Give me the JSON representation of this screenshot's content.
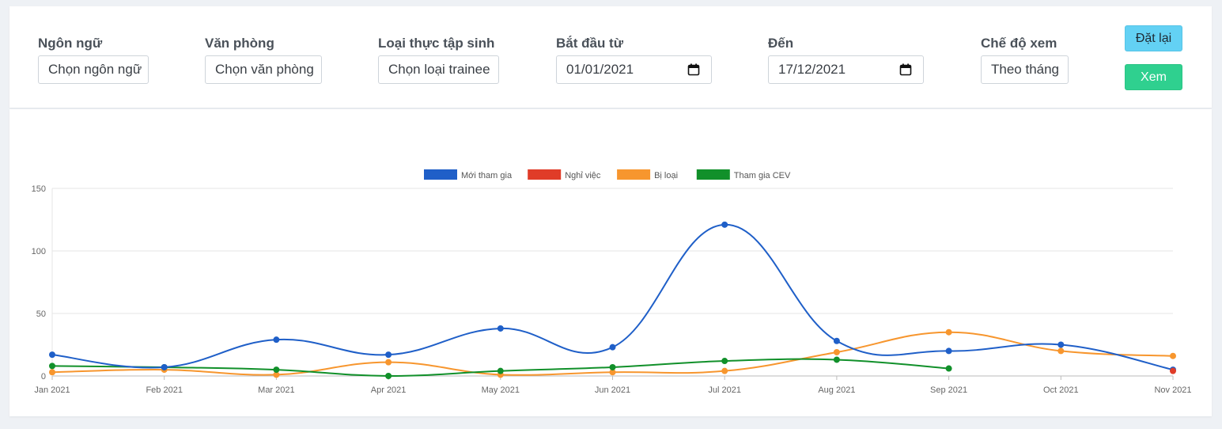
{
  "filters": {
    "language": {
      "label": "Ngôn ngữ",
      "value": "Chọn ngôn ngữ"
    },
    "office": {
      "label": "Văn phòng",
      "value": "Chọn văn phòng"
    },
    "trainee_type": {
      "label": "Loại thực tập sinh",
      "value": "Chọn loại trainee"
    },
    "start": {
      "label": "Bắt đầu từ",
      "value": "01/01/2021"
    },
    "end": {
      "label": "Đến",
      "value": "17/12/2021"
    },
    "view_mode": {
      "label": "Chế độ xem",
      "value": "Theo tháng"
    }
  },
  "buttons": {
    "reset": "Đặt lại",
    "view": "Xem"
  },
  "chart_data": {
    "type": "line",
    "title": "",
    "xlabel": "",
    "ylabel": "",
    "categories": [
      "Jan 2021",
      "Feb 2021",
      "Mar 2021",
      "Apr 2021",
      "May 2021",
      "Jun 2021",
      "Jul 2021",
      "Aug 2021",
      "Sep 2021",
      "Oct 2021",
      "Nov 2021"
    ],
    "ylim": [
      0,
      150
    ],
    "yticks": [
      0,
      50,
      100,
      150
    ],
    "grid": true,
    "legend_position": "top-center",
    "series": [
      {
        "name": "Mới tham gia",
        "color": "#1f5fc8",
        "values": [
          17,
          7,
          29,
          17,
          38,
          23,
          121,
          28,
          20,
          25,
          5
        ]
      },
      {
        "name": "Nghỉ việc",
        "color": "#e03c28",
        "values": [
          null,
          null,
          null,
          null,
          null,
          null,
          null,
          null,
          null,
          null,
          4
        ]
      },
      {
        "name": "Bị loại",
        "color": "#f7962e",
        "values": [
          3,
          5,
          1,
          11,
          1,
          3,
          4,
          19,
          35,
          20,
          16
        ]
      },
      {
        "name": "Tham gia CEV",
        "color": "#11902a",
        "values": [
          8,
          7,
          5,
          0,
          4,
          7,
          12,
          13,
          6,
          null,
          null
        ]
      }
    ]
  }
}
